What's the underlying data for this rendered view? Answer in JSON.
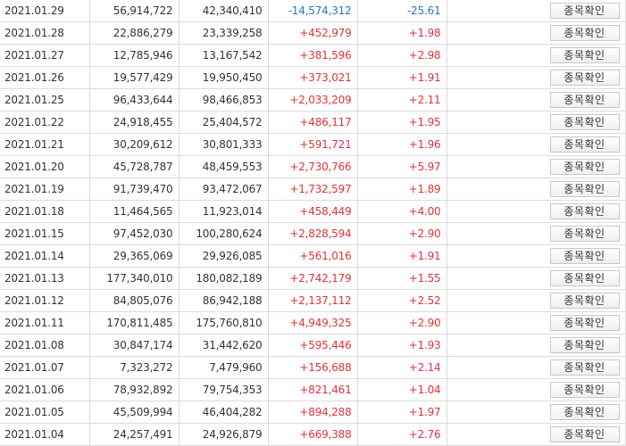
{
  "table": {
    "rows": [
      {
        "date": "2021.01.29",
        "col2": "56,914,722",
        "col3": "42,340,410",
        "change": "-14,574,312",
        "rate": "-25.61",
        "direction": "down",
        "button": "종목확인"
      },
      {
        "date": "2021.01.28",
        "col2": "22,886,279",
        "col3": "23,339,258",
        "change": "+452,979",
        "rate": "+1.98",
        "direction": "up",
        "button": "종목확인"
      },
      {
        "date": "2021.01.27",
        "col2": "12,785,946",
        "col3": "13,167,542",
        "change": "+381,596",
        "rate": "+2.98",
        "direction": "up",
        "button": "종목확인"
      },
      {
        "date": "2021.01.26",
        "col2": "19,577,429",
        "col3": "19,950,450",
        "change": "+373,021",
        "rate": "+1.91",
        "direction": "up",
        "button": "종목확인"
      },
      {
        "date": "2021.01.25",
        "col2": "96,433,644",
        "col3": "98,466,853",
        "change": "+2,033,209",
        "rate": "+2.11",
        "direction": "up",
        "button": "종목확인"
      },
      {
        "date": "2021.01.22",
        "col2": "24,918,455",
        "col3": "25,404,572",
        "change": "+486,117",
        "rate": "+1.95",
        "direction": "up",
        "button": "종목확인"
      },
      {
        "date": "2021.01.21",
        "col2": "30,209,612",
        "col3": "30,801,333",
        "change": "+591,721",
        "rate": "+1.96",
        "direction": "up",
        "button": "종목확인"
      },
      {
        "date": "2021.01.20",
        "col2": "45,728,787",
        "col3": "48,459,553",
        "change": "+2,730,766",
        "rate": "+5.97",
        "direction": "up",
        "button": "종목확인"
      },
      {
        "date": "2021.01.19",
        "col2": "91,739,470",
        "col3": "93,472,067",
        "change": "+1,732,597",
        "rate": "+1.89",
        "direction": "up",
        "button": "종목확인"
      },
      {
        "date": "2021.01.18",
        "col2": "11,464,565",
        "col3": "11,923,014",
        "change": "+458,449",
        "rate": "+4.00",
        "direction": "up",
        "button": "종목확인"
      },
      {
        "date": "2021.01.15",
        "col2": "97,452,030",
        "col3": "100,280,624",
        "change": "+2,828,594",
        "rate": "+2.90",
        "direction": "up",
        "button": "종목확인"
      },
      {
        "date": "2021.01.14",
        "col2": "29,365,069",
        "col3": "29,926,085",
        "change": "+561,016",
        "rate": "+1.91",
        "direction": "up",
        "button": "종목확인"
      },
      {
        "date": "2021.01.13",
        "col2": "177,340,010",
        "col3": "180,082,189",
        "change": "+2,742,179",
        "rate": "+1.55",
        "direction": "up",
        "button": "종목확인"
      },
      {
        "date": "2021.01.12",
        "col2": "84,805,076",
        "col3": "86,942,188",
        "change": "+2,137,112",
        "rate": "+2.52",
        "direction": "up",
        "button": "종목확인"
      },
      {
        "date": "2021.01.11",
        "col2": "170,811,485",
        "col3": "175,760,810",
        "change": "+4,949,325",
        "rate": "+2.90",
        "direction": "up",
        "button": "종목확인"
      },
      {
        "date": "2021.01.08",
        "col2": "30,847,174",
        "col3": "31,442,620",
        "change": "+595,446",
        "rate": "+1.93",
        "direction": "up",
        "button": "종목확인"
      },
      {
        "date": "2021.01.07",
        "col2": "7,323,272",
        "col3": "7,479,960",
        "change": "+156,688",
        "rate": "+2.14",
        "direction": "up",
        "button": "종목확인"
      },
      {
        "date": "2021.01.06",
        "col2": "78,932,892",
        "col3": "79,754,353",
        "change": "+821,461",
        "rate": "+1.04",
        "direction": "up",
        "button": "종목확인"
      },
      {
        "date": "2021.01.05",
        "col2": "45,509,994",
        "col3": "46,404,282",
        "change": "+894,288",
        "rate": "+1.97",
        "direction": "up",
        "button": "종목확인"
      },
      {
        "date": "2021.01.04",
        "col2": "24,257,491",
        "col3": "24,926,879",
        "change": "+669,388",
        "rate": "+2.76",
        "direction": "up",
        "button": "종목확인"
      }
    ]
  },
  "colors": {
    "up": "#e0323c",
    "down": "#2a74c9",
    "border": "#dcdcdc",
    "text": "#333333"
  }
}
